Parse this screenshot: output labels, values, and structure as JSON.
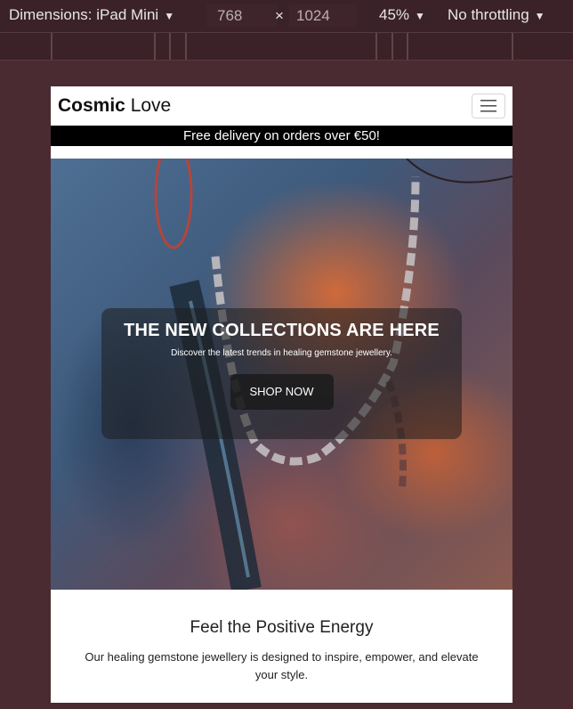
{
  "devtools": {
    "dimensions_label": "Dimensions: iPad Mini",
    "width": "768",
    "times": "×",
    "height": "1024",
    "zoom": "45%",
    "throttling": "No throttling"
  },
  "navbar": {
    "brand_bold": "Cosmic",
    "brand_rest": " Love"
  },
  "promo": {
    "text": "Free delivery on orders over €50!"
  },
  "hero": {
    "title": "THE NEW COLLECTIONS ARE HERE",
    "subtitle": "Discover the latest trends in healing gemstone jewellery.",
    "cta_label": "SHOP NOW"
  },
  "section": {
    "title": "Feel the Positive Energy",
    "text": "Our healing gemstone jewellery is designed to inspire, empower, and elevate your style."
  }
}
